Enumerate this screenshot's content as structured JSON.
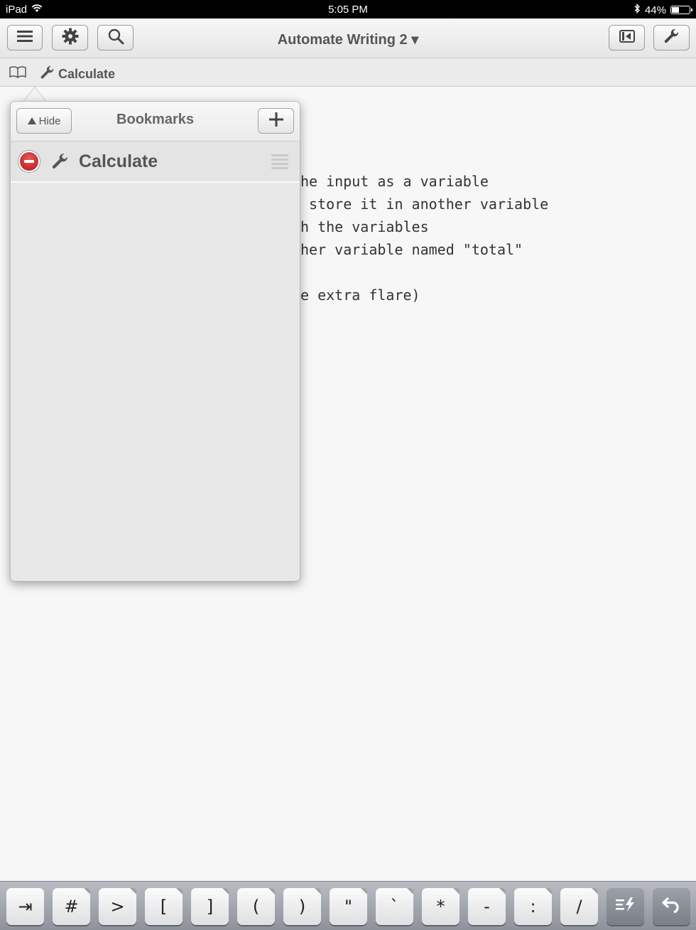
{
  "status_bar": {
    "device": "iPad",
    "time": "5:05 PM",
    "battery": "44%",
    "battery_level": 0.44
  },
  "toolbar": {
    "title": "Automate Writing 2 ▾"
  },
  "breadcrumb": {
    "label": "Calculate"
  },
  "editor": {
    "lines": [
      "he input as a variable",
      " store it in another variable",
      "h the variables",
      "her variable named \"total\"",
      "",
      "e extra flare)"
    ]
  },
  "bookmarks_popover": {
    "hide_label": "Hide",
    "title": "Bookmarks",
    "items": [
      {
        "label": "Calculate"
      }
    ]
  },
  "accessory_keys": [
    "⇥",
    "#",
    ">",
    "[",
    "]",
    "(",
    ")",
    "\"",
    "`",
    "*",
    "-",
    ":",
    "/"
  ]
}
